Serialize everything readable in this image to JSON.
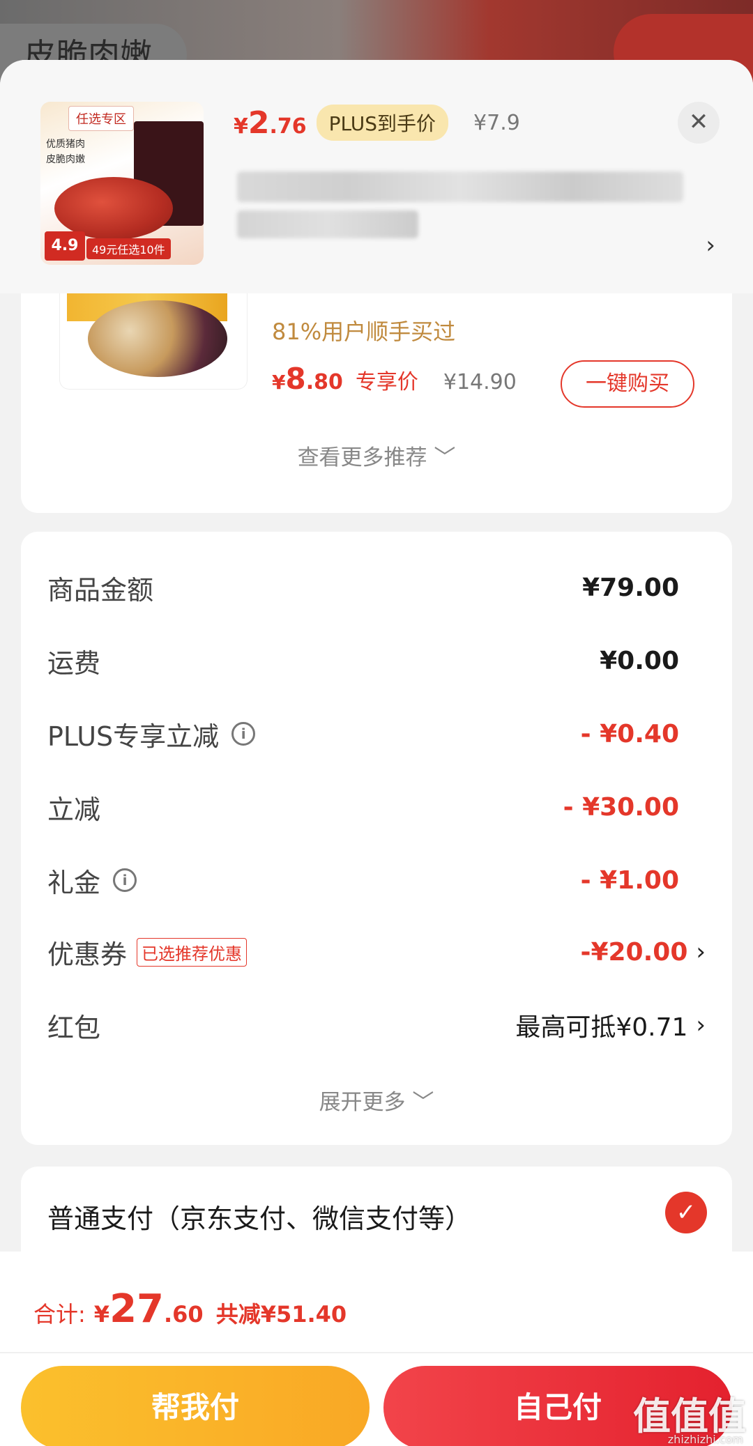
{
  "background": {
    "chip_text": "皮脆肉嫩"
  },
  "product": {
    "thumb": {
      "tag": "任选专区",
      "line1": "优质猪肉",
      "line2": "皮脆肉嫩",
      "price_tag": "4.9",
      "deal": "49元任选10件"
    },
    "price_yen": "¥",
    "price_int": "2",
    "price_dec": ".76",
    "plus_label": "PLUS到手价",
    "original_price": "¥7.9",
    "close_icon": "close-icon"
  },
  "recommendation": {
    "bought_text": "81%用户顺手买过",
    "price_yen": "¥",
    "price_int": "8",
    "price_dec": ".80",
    "exclusive_label": "专享价",
    "old_price": "¥14.90",
    "buy_button": "一键购买",
    "more_link": "查看更多推荐 ﹀"
  },
  "amounts": {
    "rows": [
      {
        "label": "商品金额",
        "value": "¥79.00"
      },
      {
        "label": "运费",
        "value": "¥0.00"
      },
      {
        "label": "PLUS专享立减",
        "value": "- ¥0.40"
      },
      {
        "label": "立减",
        "value": "- ¥30.00"
      },
      {
        "label": "礼金",
        "value": "- ¥1.00"
      },
      {
        "label": "优惠券",
        "badge": "已选推荐优惠",
        "value": "-¥20.00"
      },
      {
        "label": "红包",
        "value": "最高可抵¥0.71"
      }
    ],
    "expand_link": "展开更多 ﹀"
  },
  "payment": {
    "option_label": "普通支付（京东支付、微信支付等）"
  },
  "footer": {
    "total_label": "合计:",
    "total_yen": "¥",
    "total_int": "27",
    "total_dec": ".60",
    "saved_text": "共减¥51.40",
    "help_pay_button": "帮我付",
    "self_pay_button": "自己付",
    "watermark": "值值值",
    "watermark_sub": "zhizhizhi.com"
  },
  "colors": {
    "accent_red": "#e4372a",
    "plus_gold": "#f9e6ae",
    "help_button": "#fbc02d"
  }
}
